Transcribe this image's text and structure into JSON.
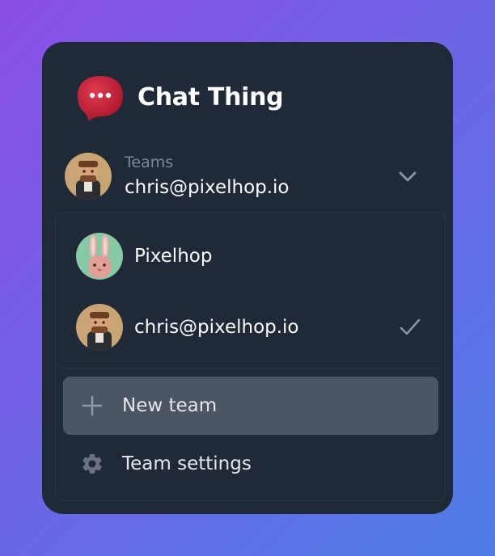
{
  "app": {
    "title": "Chat Thing",
    "logo_icon": "chat-bubble-dots-icon",
    "brand_color": "#c5213a"
  },
  "switcher": {
    "label": "Teams",
    "value": "chris@pixelhop.io",
    "avatar_icon": "user-avatar",
    "toggle_icon": "chevron-down-icon"
  },
  "menu": {
    "teams": [
      {
        "label": "Pixelhop",
        "avatar_icon": "bunny-avatar",
        "selected": false
      },
      {
        "label": "chris@pixelhop.io",
        "avatar_icon": "user-avatar",
        "selected": true
      }
    ],
    "actions": [
      {
        "label": "New team",
        "icon": "plus-icon",
        "highlighted": true
      },
      {
        "label": "Team settings",
        "icon": "gear-icon",
        "highlighted": false
      }
    ]
  },
  "colors": {
    "panel_bg": "#1f2937",
    "highlight_bg": "#4b5563",
    "muted_text": "#7d8896",
    "gradient_start": "#8b4fe6",
    "gradient_end": "#4d7de6"
  }
}
